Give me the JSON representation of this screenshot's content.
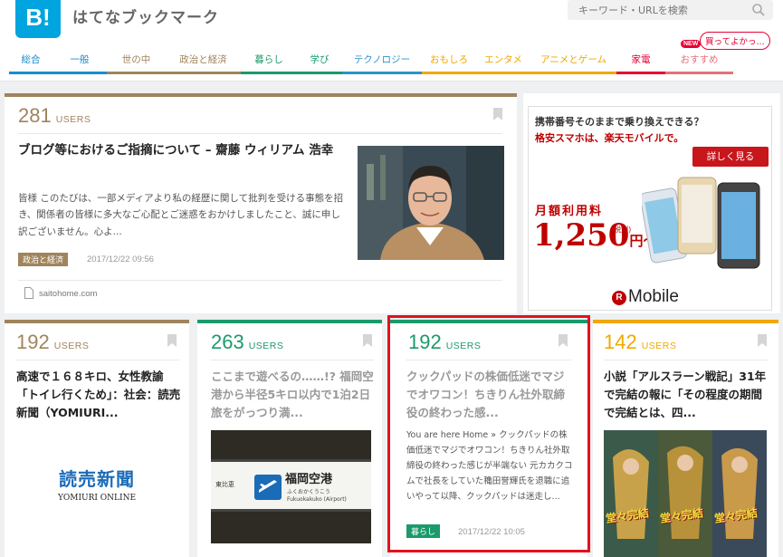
{
  "header": {
    "logo": "B!",
    "brand": "はてなブックマーク",
    "search_placeholder": "キーワード・URLを検索",
    "new_badge": "NEW",
    "bubble": "買ってよかっ...",
    "nav": [
      {
        "label": "総合",
        "color": "#1a8ccc"
      },
      {
        "label": "一般",
        "color": "#1a8ccc"
      },
      {
        "label": "世の中",
        "color": "#a0845c"
      },
      {
        "label": "政治と経済",
        "color": "#a0845c"
      },
      {
        "label": "暮らし",
        "color": "#1b9a6b"
      },
      {
        "label": "学び",
        "color": "#1b9a6b"
      },
      {
        "label": "テクノロジー",
        "color": "#2d93c8"
      },
      {
        "label": "おもしろ",
        "color": "#f0a800"
      },
      {
        "label": "エンタメ",
        "color": "#f0a800"
      },
      {
        "label": "アニメとゲーム",
        "color": "#f0a800"
      },
      {
        "label": "家電",
        "color": "#e60033"
      },
      {
        "label": "おすすめ",
        "color": "#e6707a"
      }
    ]
  },
  "main": {
    "users": "281",
    "users_label": "USERS",
    "title": "ブログ等におけるご指摘について – 齋藤 ウィリアム 浩幸",
    "text": "皆様 このたびは、一部メディアより私の経歴に関して批判を受ける事態を招き、関係者の皆様に多大なご心配とご迷惑をおかけしましたこと、誠に申し訳ございません。心よ...",
    "tag": "政治と経済",
    "date": "2017/12/22 09:56",
    "site": "saitohome.com"
  },
  "ad": {
    "line1": "携帯番号そのままで乗り換えできる？",
    "line2": "格安スマホは、楽天モバイルで。",
    "button": "詳しく見る",
    "price_label": "月額利用料",
    "price": "1,250",
    "price_tax": "(税別)",
    "price_unit": "円〜",
    "brand": "Mobile"
  },
  "cards": [
    {
      "users": "192",
      "users_label": "USERS",
      "title": "高速で１６８キロ、女性教諭「トイレ行くため」：社会：読売新聞（YOMIURI...",
      "logo_line1": "読売新聞",
      "logo_line2": "YOMIURI ONLINE"
    },
    {
      "users": "263",
      "users_label": "USERS",
      "title": "ここまで遊べるの……!? 福岡空港から半径5キロ以内で1泊2日旅をがっつり満...",
      "sign_main": "福岡空港",
      "sign_sub": "ふくおかくうこう",
      "sign_en": "Fukuokakuko (Airport)",
      "sign_left": "東比恵"
    },
    {
      "users": "192",
      "users_label": "USERS",
      "title": "クックパッドの株価低迷でマジでオワコン！ちきりん社外取締役の終わった感...",
      "text": "You are here Home » クックパッドの株価低迷でマジでオワコン！ちきりん社外取締役の終わった感じが半端ない 元カカクコムで社長をしていた穐田誉輝氏を退職に追いやって以降、クックパッドは迷走し...",
      "tag": "暮らし",
      "date": "2017/12/22 10:05"
    },
    {
      "users": "142",
      "users_label": "USERS",
      "title": "小説「アルスラーン戦記」31年で完結の報に「その程度の期間で完結とは、四...",
      "book_title": "堂々完結"
    }
  ]
}
